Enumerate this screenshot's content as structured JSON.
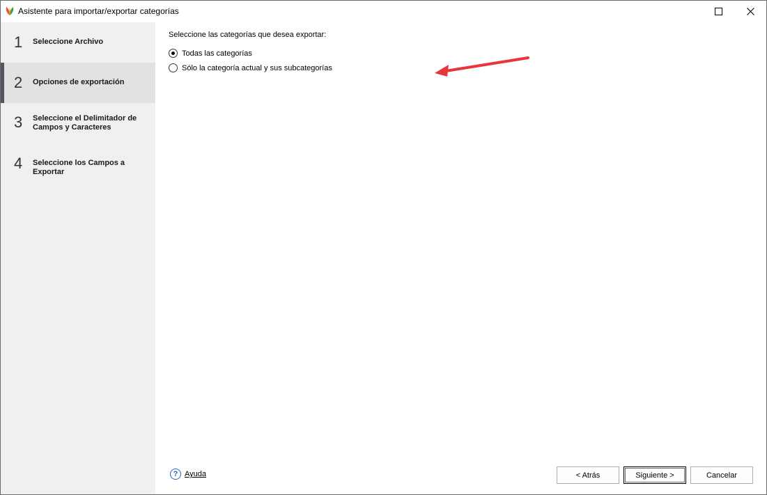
{
  "window": {
    "title": "Asistente para importar/exportar categorías"
  },
  "sidebar": {
    "steps": [
      {
        "num": "1",
        "label": "Seleccione Archivo",
        "active": false
      },
      {
        "num": "2",
        "label": "Opciones de exportación",
        "active": true
      },
      {
        "num": "3",
        "label": "Seleccione el Delimitador de Campos y Caracteres",
        "active": false
      },
      {
        "num": "4",
        "label": "Seleccione los Campos a Exportar",
        "active": false
      }
    ]
  },
  "content": {
    "prompt": "Seleccione las categorías que desea exportar:",
    "options": [
      {
        "label": "Todas las categorías",
        "checked": true
      },
      {
        "label": "Sólo la categoría actual y sus subcategorías",
        "checked": false
      }
    ]
  },
  "footer": {
    "help_label": "Ayuda",
    "help_icon": "question-circle-icon",
    "back_label": "< Atrás",
    "next_label": "Siguiente >",
    "cancel_label": "Cancelar"
  },
  "colors": {
    "annotation_arrow": "#e8363b",
    "help_icon": "#2a63b7",
    "active_step_bg": "#e2e2e2",
    "sidebar_bg": "#f0f0f0"
  }
}
